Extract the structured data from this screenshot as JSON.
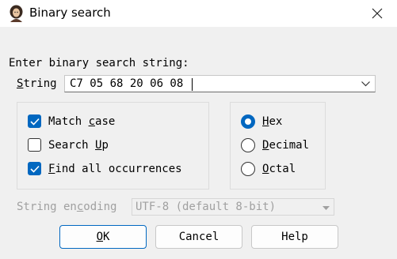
{
  "window": {
    "title": "Binary search",
    "icon": "portrait-icon",
    "close_icon": "close-icon"
  },
  "search": {
    "prompt": "Enter binary search string:",
    "string_label_prefix": "S",
    "string_label_rest": "tring",
    "value": "C7 05 68 20 06 08"
  },
  "options": [
    {
      "pre": "Match ",
      "u": "c",
      "post": "ase",
      "checked": true
    },
    {
      "pre": "Search ",
      "u": "U",
      "post": "p",
      "checked": false
    },
    {
      "pre": "",
      "u": "F",
      "post": "ind all occurrences",
      "checked": true
    }
  ],
  "format": [
    {
      "pre": "",
      "u": "H",
      "post": "ex",
      "selected": true
    },
    {
      "pre": "",
      "u": "D",
      "post": "ecimal",
      "selected": false
    },
    {
      "pre": "",
      "u": "O",
      "post": "ctal",
      "selected": false
    }
  ],
  "encoding": {
    "label_pre": "String en",
    "label_u": "c",
    "label_post": "oding",
    "value": "UTF-8 (default 8-bit)"
  },
  "buttons": {
    "ok_pre": "",
    "ok_u": "O",
    "ok_post": "K",
    "cancel": "Cancel",
    "help": "Help"
  },
  "colors": {
    "accent": "#0067c0",
    "disabled_text": "#a0a0a0"
  }
}
